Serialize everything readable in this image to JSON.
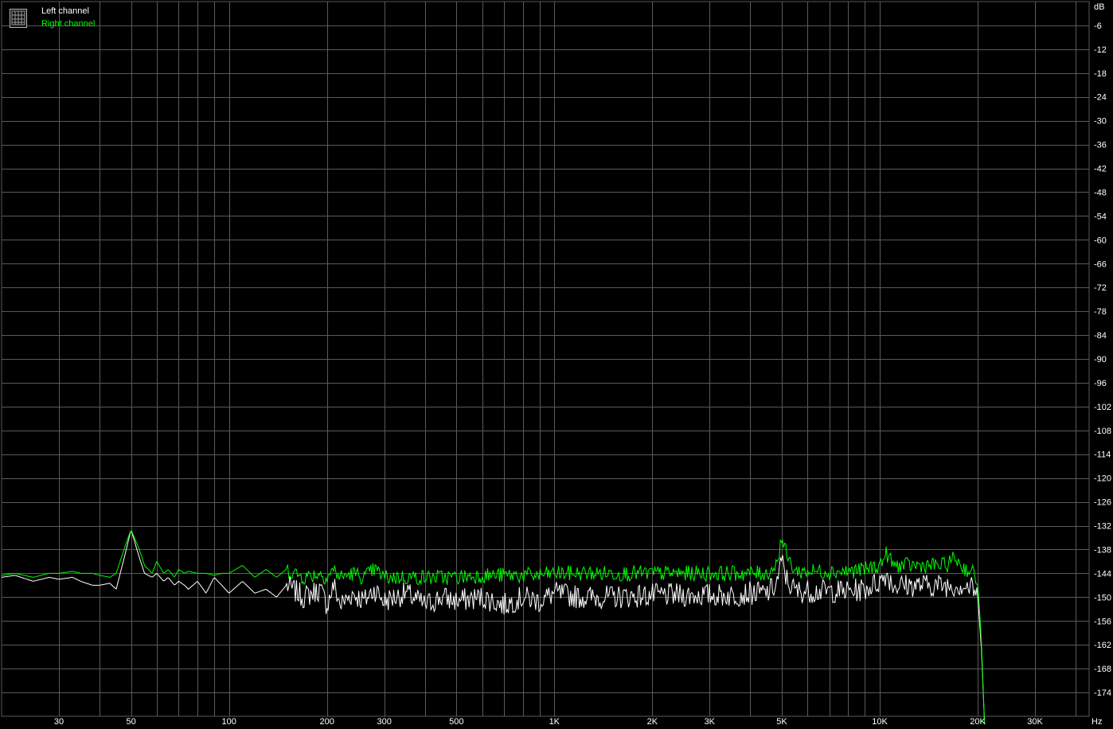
{
  "chart_data": {
    "type": "line",
    "title": "",
    "xlabel": "",
    "ylabel": "",
    "x_unit": "Hz",
    "y_unit": "dB",
    "x_scale": "log",
    "xlim": [
      20,
      44000
    ],
    "ylim": [
      -180,
      0
    ],
    "grid": true,
    "legend": "top-left",
    "background": "#000000",
    "grid_color": "#5a5a5a",
    "x_ticks": [
      {
        "value": 30,
        "label": "30"
      },
      {
        "value": 50,
        "label": "50"
      },
      {
        "value": 100,
        "label": "100"
      },
      {
        "value": 200,
        "label": "200"
      },
      {
        "value": 300,
        "label": "300"
      },
      {
        "value": 500,
        "label": "500"
      },
      {
        "value": 1000,
        "label": "1K"
      },
      {
        "value": 2000,
        "label": "2K"
      },
      {
        "value": 3000,
        "label": "3K"
      },
      {
        "value": 5000,
        "label": "5K"
      },
      {
        "value": 10000,
        "label": "10K"
      },
      {
        "value": 20000,
        "label": "20K"
      },
      {
        "value": 30000,
        "label": "30K"
      }
    ],
    "y_ticks": [
      {
        "value": -6,
        "label": "-6"
      },
      {
        "value": -12,
        "label": "-12"
      },
      {
        "value": -18,
        "label": "-18"
      },
      {
        "value": -24,
        "label": "-24"
      },
      {
        "value": -30,
        "label": "-30"
      },
      {
        "value": -36,
        "label": "-36"
      },
      {
        "value": -42,
        "label": "-42"
      },
      {
        "value": -48,
        "label": "-48"
      },
      {
        "value": -54,
        "label": "-54"
      },
      {
        "value": -60,
        "label": "-60"
      },
      {
        "value": -66,
        "label": "-66"
      },
      {
        "value": -72,
        "label": "-72"
      },
      {
        "value": -78,
        "label": "-78"
      },
      {
        "value": -84,
        "label": "-84"
      },
      {
        "value": -90,
        "label": "-90"
      },
      {
        "value": -96,
        "label": "-96"
      },
      {
        "value": -102,
        "label": "-102"
      },
      {
        "value": -108,
        "label": "-108"
      },
      {
        "value": -114,
        "label": "-114"
      },
      {
        "value": -120,
        "label": "-120"
      },
      {
        "value": -126,
        "label": "-126"
      },
      {
        "value": -132,
        "label": "-132"
      },
      {
        "value": -138,
        "label": "-138"
      },
      {
        "value": -144,
        "label": "-144"
      },
      {
        "value": -150,
        "label": "-150"
      },
      {
        "value": -156,
        "label": "-156"
      },
      {
        "value": -162,
        "label": "-162"
      },
      {
        "value": -168,
        "label": "-168"
      },
      {
        "value": -174,
        "label": "-174"
      }
    ],
    "series": [
      {
        "name": "Left channel",
        "color": "#ffffff",
        "points": [
          [
            20,
            -145
          ],
          [
            22,
            -144.5
          ],
          [
            25,
            -146
          ],
          [
            28,
            -145
          ],
          [
            30,
            -145.5
          ],
          [
            33,
            -145
          ],
          [
            35,
            -146
          ],
          [
            38,
            -147
          ],
          [
            40,
            -147
          ],
          [
            43,
            -146.5
          ],
          [
            45,
            -148
          ],
          [
            48,
            -139
          ],
          [
            50,
            -133
          ],
          [
            53,
            -140
          ],
          [
            55,
            -144
          ],
          [
            58,
            -145
          ],
          [
            60,
            -144
          ],
          [
            63,
            -146
          ],
          [
            65,
            -145
          ],
          [
            68,
            -147
          ],
          [
            70,
            -146
          ],
          [
            73,
            -147
          ],
          [
            75,
            -148
          ],
          [
            80,
            -146
          ],
          [
            85,
            -149
          ],
          [
            90,
            -145
          ],
          [
            95,
            -147
          ],
          [
            100,
            -149
          ],
          [
            110,
            -146
          ],
          [
            120,
            -149
          ],
          [
            130,
            -148
          ],
          [
            140,
            -150
          ],
          [
            150,
            -147
          ],
          [
            170,
            -150
          ],
          [
            190,
            -148
          ],
          [
            200,
            -152
          ],
          [
            210,
            -147
          ],
          [
            220,
            -152
          ],
          [
            240,
            -149
          ],
          [
            260,
            -151
          ],
          [
            280,
            -148
          ],
          [
            300,
            -151
          ],
          [
            350,
            -149
          ],
          [
            400,
            -152
          ],
          [
            450,
            -150
          ],
          [
            500,
            -151
          ],
          [
            600,
            -150
          ],
          [
            700,
            -152
          ],
          [
            800,
            -150
          ],
          [
            900,
            -151
          ],
          [
            1000,
            -149
          ],
          [
            1200,
            -150
          ],
          [
            1500,
            -150
          ],
          [
            2000,
            -149.5
          ],
          [
            2500,
            -149.5
          ],
          [
            3000,
            -149.5
          ],
          [
            3500,
            -149.5
          ],
          [
            4000,
            -149
          ],
          [
            4500,
            -149
          ],
          [
            4800,
            -147
          ],
          [
            5000,
            -141
          ],
          [
            5200,
            -146
          ],
          [
            5500,
            -148.5
          ],
          [
            6000,
            -148.5
          ],
          [
            7000,
            -148.5
          ],
          [
            8000,
            -148.5
          ],
          [
            9000,
            -148
          ],
          [
            10000,
            -146
          ],
          [
            10500,
            -144
          ],
          [
            11000,
            -147
          ],
          [
            12000,
            -147
          ],
          [
            14000,
            -147
          ],
          [
            16000,
            -147
          ],
          [
            18000,
            -147
          ],
          [
            19500,
            -148
          ],
          [
            20000,
            -150
          ],
          [
            20500,
            -162
          ],
          [
            21000,
            -182
          ]
        ]
      },
      {
        "name": "Right channel",
        "color": "#00ff00",
        "points": [
          [
            20,
            -144.5
          ],
          [
            22,
            -144
          ],
          [
            25,
            -145
          ],
          [
            28,
            -144
          ],
          [
            30,
            -144
          ],
          [
            33,
            -143.5
          ],
          [
            35,
            -144
          ],
          [
            38,
            -144
          ],
          [
            40,
            -144.5
          ],
          [
            43,
            -145
          ],
          [
            45,
            -144
          ],
          [
            48,
            -137
          ],
          [
            50,
            -133
          ],
          [
            53,
            -138
          ],
          [
            55,
            -142
          ],
          [
            58,
            -144
          ],
          [
            60,
            -141
          ],
          [
            63,
            -144
          ],
          [
            65,
            -143
          ],
          [
            68,
            -145
          ],
          [
            70,
            -143
          ],
          [
            73,
            -144
          ],
          [
            75,
            -143.5
          ],
          [
            80,
            -144
          ],
          [
            85,
            -144
          ],
          [
            90,
            -144.5
          ],
          [
            95,
            -144
          ],
          [
            100,
            -144
          ],
          [
            110,
            -142
          ],
          [
            120,
            -145
          ],
          [
            130,
            -143
          ],
          [
            140,
            -145
          ],
          [
            150,
            -143
          ],
          [
            170,
            -145
          ],
          [
            190,
            -144
          ],
          [
            200,
            -145
          ],
          [
            210,
            -143
          ],
          [
            220,
            -145
          ],
          [
            240,
            -144
          ],
          [
            260,
            -145
          ],
          [
            280,
            -143
          ],
          [
            300,
            -145
          ],
          [
            350,
            -145
          ],
          [
            400,
            -145
          ],
          [
            450,
            -145
          ],
          [
            500,
            -145
          ],
          [
            600,
            -144.5
          ],
          [
            700,
            -144.5
          ],
          [
            800,
            -144.5
          ],
          [
            900,
            -144.5
          ],
          [
            1000,
            -144
          ],
          [
            1200,
            -144
          ],
          [
            1500,
            -144
          ],
          [
            2000,
            -144
          ],
          [
            2500,
            -144
          ],
          [
            3000,
            -144
          ],
          [
            3500,
            -144
          ],
          [
            4000,
            -144
          ],
          [
            4500,
            -144
          ],
          [
            4800,
            -142
          ],
          [
            5000,
            -135
          ],
          [
            5200,
            -140
          ],
          [
            5500,
            -143.5
          ],
          [
            6000,
            -143.5
          ],
          [
            7000,
            -143.5
          ],
          [
            8000,
            -143.5
          ],
          [
            9000,
            -143
          ],
          [
            10000,
            -142
          ],
          [
            10500,
            -139
          ],
          [
            11000,
            -142
          ],
          [
            12000,
            -142
          ],
          [
            14000,
            -142
          ],
          [
            16000,
            -142
          ],
          [
            17000,
            -140
          ],
          [
            18000,
            -142.5
          ],
          [
            19500,
            -144
          ],
          [
            20000,
            -146
          ],
          [
            20500,
            -160
          ],
          [
            21000,
            -182
          ]
        ]
      }
    ]
  }
}
